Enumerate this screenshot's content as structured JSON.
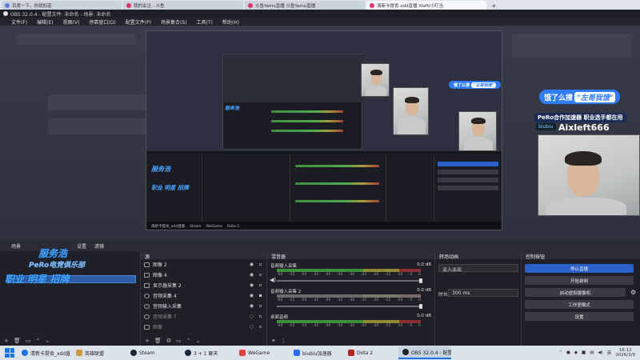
{
  "browser": {
    "tabs": [
      {
        "label": "百度一下，你就知道",
        "active": false
      },
      {
        "label": "我的关注 - 斗鱼",
        "active": false
      },
      {
        "label": "斗鱼Yamo直播 斗鱼Yamo直播",
        "active": false
      },
      {
        "label": "清新卡提肯 xdd直播 Xlefti小叮当",
        "active": true
      }
    ],
    "new_tab": "+"
  },
  "obs": {
    "title": "OBS 32.0.4 - 配置文件: 未命名 - 场景: 未命名",
    "menu": [
      "文件(F)",
      "编辑(E)",
      "视图(V)",
      "停靠窗口(D)",
      "配置文件(P)",
      "场景集合(S)",
      "工具(T)",
      "帮助(H)"
    ]
  },
  "preview": {
    "overlay": {
      "banner_prefix": "饿了么搜",
      "banner_highlight": "\"左哥我饿\"",
      "sub_line": "PeRo合作加速器 职业选手都在用",
      "bilibili": "biubiu",
      "name": "Aixleft666"
    }
  },
  "docks": {
    "header_tabs": [
      "场景",
      "设置",
      "滤镜"
    ],
    "logo": {
      "line1": "服务浩",
      "line2": "PeRo电竞俱乐部",
      "line3": "职业 明星 招牌"
    },
    "scenes": {
      "title": "场景",
      "selected": "场景"
    },
    "sources": {
      "title": "源",
      "items": [
        {
          "label": "图像 2",
          "dim": false
        },
        {
          "label": "图像 4",
          "dim": false
        },
        {
          "label": "显示器采集 2",
          "dim": false
        },
        {
          "label": "音频采集 4",
          "dim": false
        },
        {
          "label": "音频输入采集",
          "dim": false
        },
        {
          "label": "音频采集 7",
          "dim": true
        },
        {
          "label": "图像",
          "dim": true
        }
      ]
    },
    "mixer": {
      "title": "混音器",
      "channels": [
        {
          "name": "音频输入采集",
          "db": "0.0 dB"
        },
        {
          "name": "音频输入采集 2",
          "db": "0.0 dB"
        },
        {
          "name": "桌面音频",
          "db": "0.0 dB"
        }
      ],
      "scale": [
        "-60",
        "-55",
        "-50",
        "-45",
        "-40",
        "-35",
        "-30",
        "-25",
        "-20",
        "-15",
        "-10",
        "-5",
        "0"
      ]
    },
    "transitions": {
      "title": "转场动画",
      "type": "淡入淡出",
      "duration_label": "时长",
      "duration": "300 ms"
    },
    "controls": {
      "title": "控制按钮",
      "buttons": [
        "停止直播",
        "开始录制",
        "启动虚拟摄像机",
        "工作室模式",
        "设置"
      ]
    }
  },
  "taskbar": {
    "items": [
      {
        "label": "清新卡提肯_xdd直播",
        "color": "#1a73e8",
        "active": false
      },
      {
        "label": "英雄联盟",
        "color": "#c89b3c",
        "active": false
      },
      {
        "label": "Steam",
        "color": "#1b2838",
        "active": false
      },
      {
        "label": "3 + 1 聊天",
        "color": "#1b2838",
        "active": false
      },
      {
        "label": "WeGame",
        "color": "#e0443a",
        "active": false
      },
      {
        "label": "biubiu加速器",
        "color": "#2c6cf6",
        "active": false
      },
      {
        "label": "Dota 2",
        "color": "#b0251d",
        "active": false
      },
      {
        "label": "OBS 32.0.4 - 配置...",
        "color": "#222222",
        "active": true
      }
    ],
    "ime": "英",
    "time": "16:12",
    "date": "2026/3/9"
  }
}
